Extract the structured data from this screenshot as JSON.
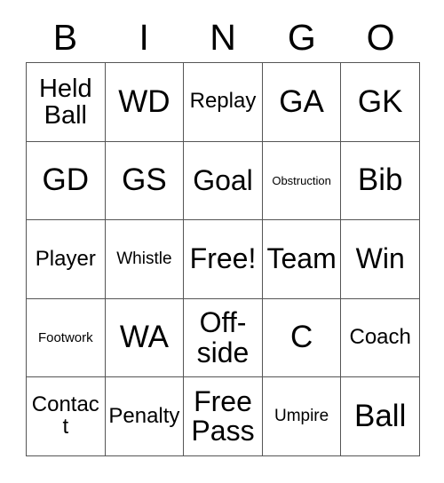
{
  "card": {
    "type": "bingo-card",
    "theme": "netball",
    "columns": 5,
    "rows": 5,
    "border_color": "#555555",
    "background_color": "#ffffff",
    "text_color": "#000000"
  },
  "header": {
    "letters": [
      {
        "label": "B"
      },
      {
        "label": "I"
      },
      {
        "label": "N"
      },
      {
        "label": "G"
      },
      {
        "label": "O"
      }
    ]
  },
  "grid": {
    "cells": [
      {
        "label": "Held Ball",
        "size": "lg"
      },
      {
        "label": "WD",
        "size": "xxl"
      },
      {
        "label": "Replay",
        "size": "md"
      },
      {
        "label": "GA",
        "size": "xxl"
      },
      {
        "label": "GK",
        "size": "xxl"
      },
      {
        "label": "GD",
        "size": "xxl"
      },
      {
        "label": "GS",
        "size": "xxl"
      },
      {
        "label": "Goal",
        "size": "xl"
      },
      {
        "label": "Obstruction",
        "size": "xxs"
      },
      {
        "label": "Bib",
        "size": "xxl"
      },
      {
        "label": "Player",
        "size": "md"
      },
      {
        "label": "Whistle",
        "size": "sm"
      },
      {
        "label": "Free!",
        "size": "xl"
      },
      {
        "label": "Team",
        "size": "xl"
      },
      {
        "label": "Win",
        "size": "xl"
      },
      {
        "label": "Footwork",
        "size": "xs"
      },
      {
        "label": "WA",
        "size": "xxl"
      },
      {
        "label": "Off-side",
        "size": "xl"
      },
      {
        "label": "C",
        "size": "xxl"
      },
      {
        "label": "Coach",
        "size": "md"
      },
      {
        "label": "Contact",
        "size": "md"
      },
      {
        "label": "Penalty",
        "size": "md"
      },
      {
        "label": "Free Pass",
        "size": "xl"
      },
      {
        "label": "Umpire",
        "size": "sm"
      },
      {
        "label": "Ball",
        "size": "xxl"
      }
    ]
  }
}
